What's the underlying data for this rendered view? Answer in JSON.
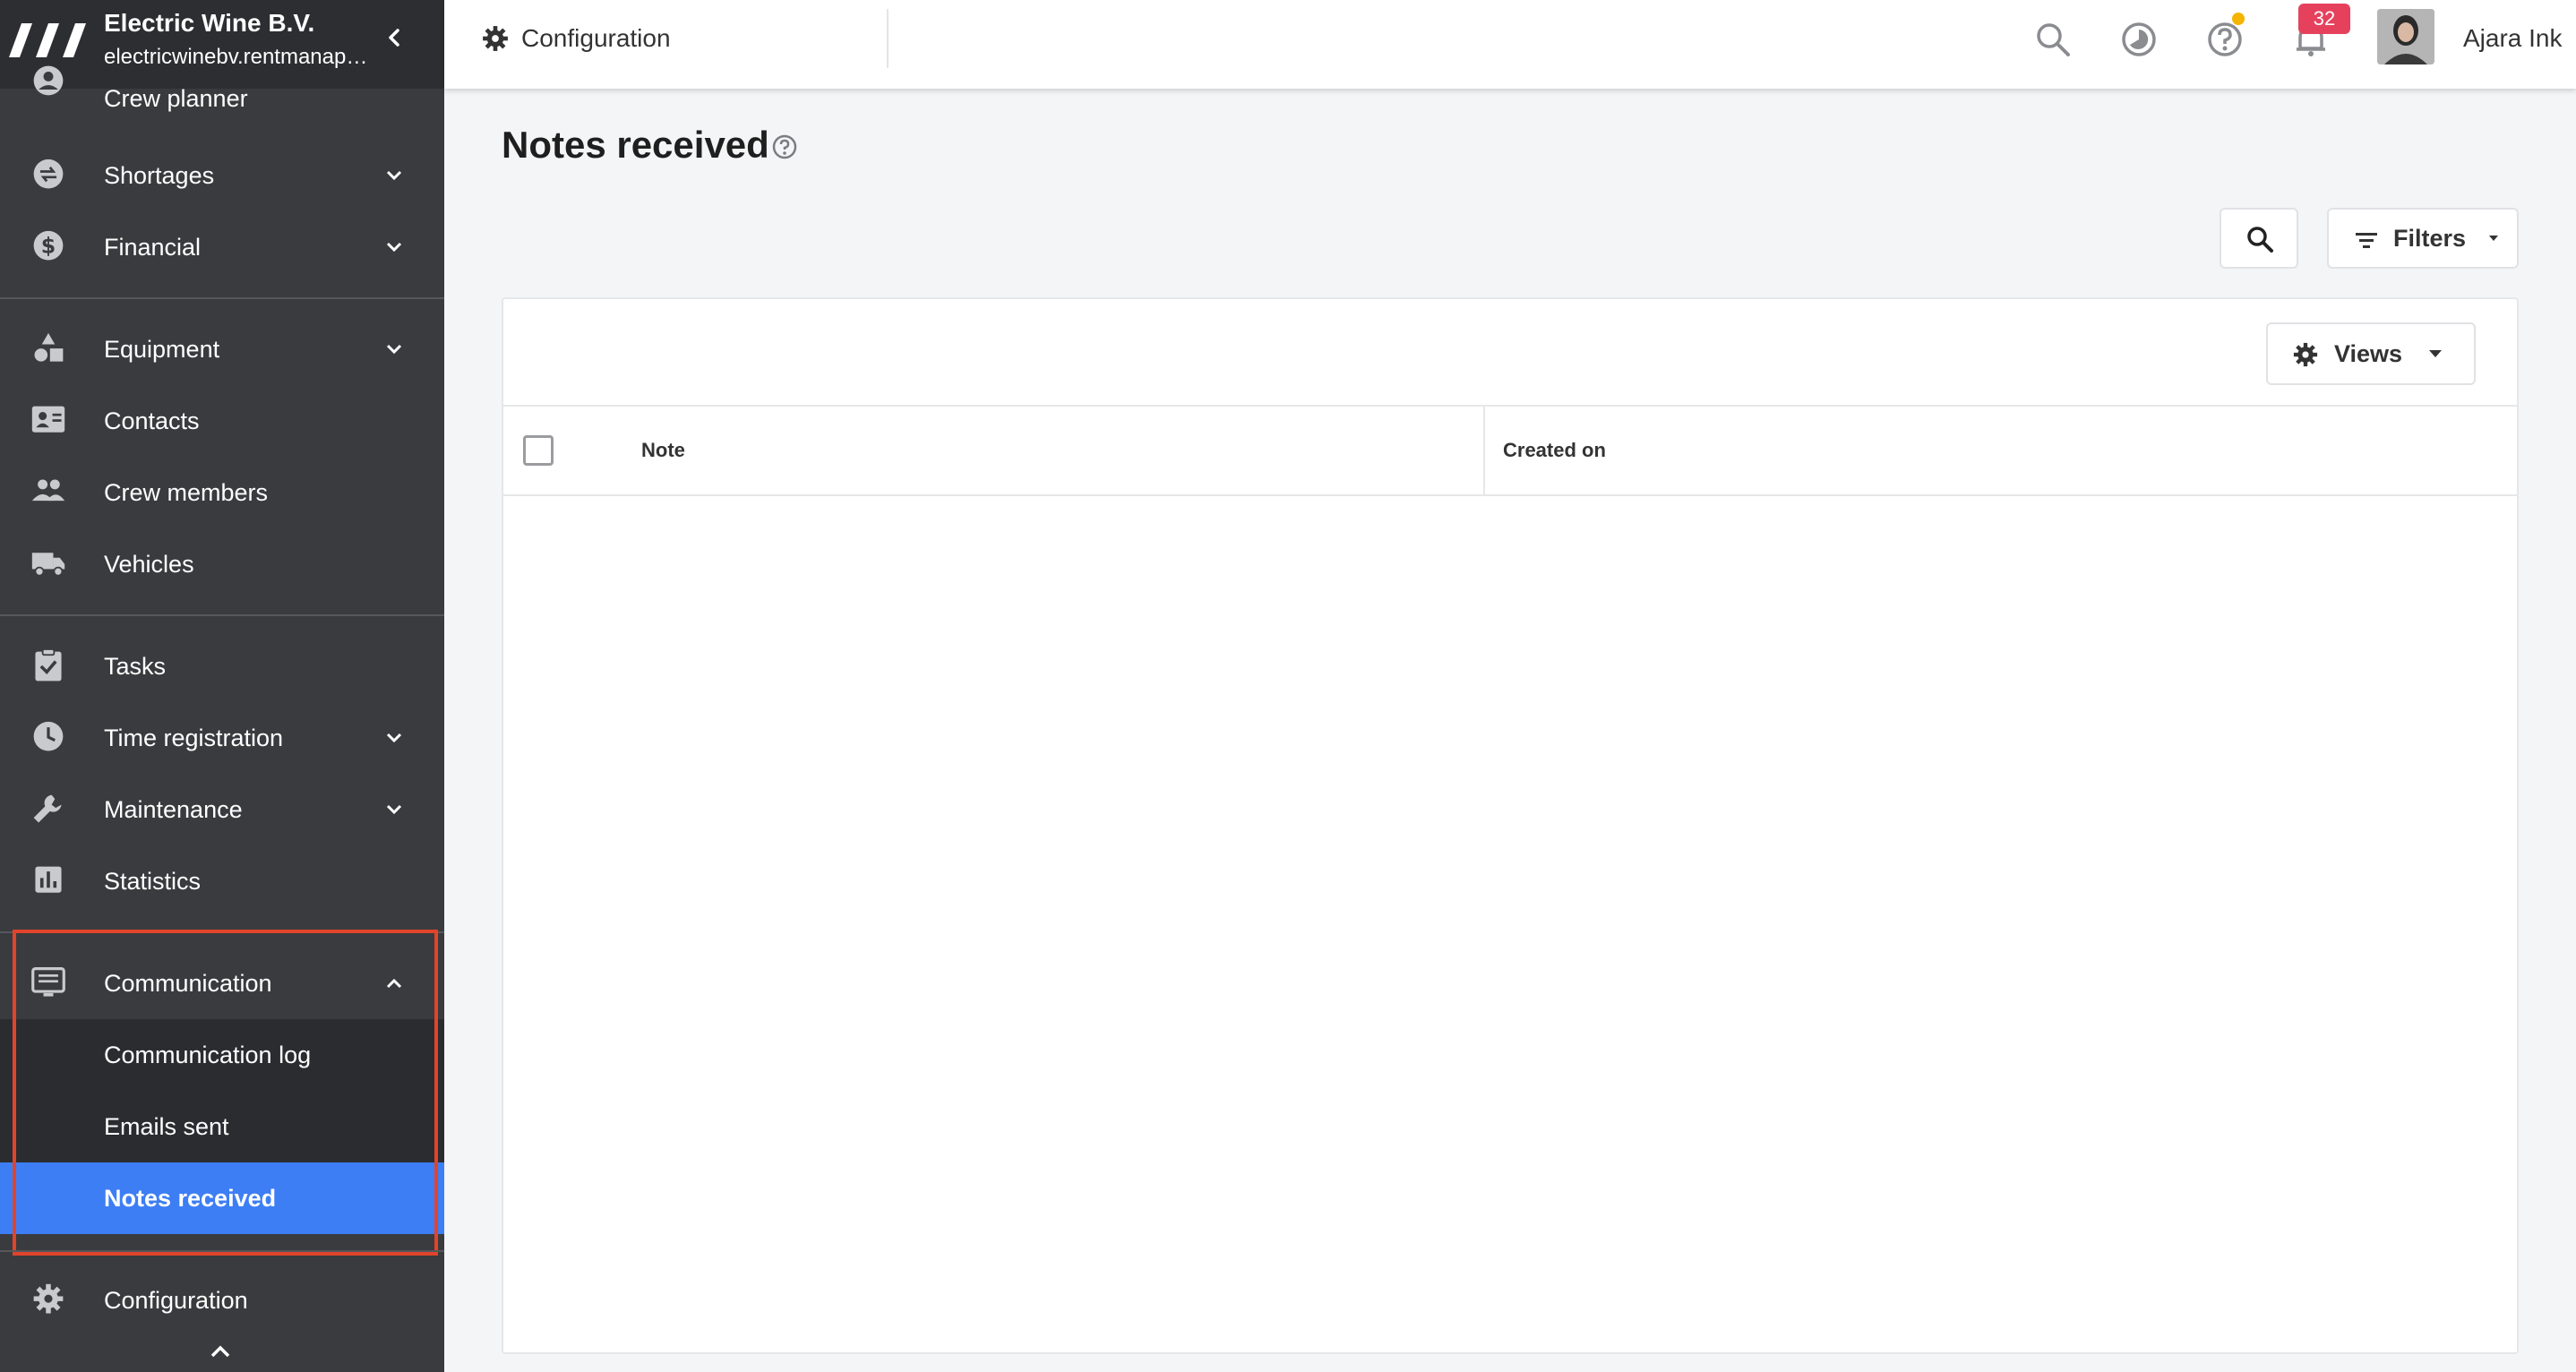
{
  "brand": {
    "name": "Electric Wine B.V.",
    "url": "electricwinebv.rentmanapp.com"
  },
  "sidebar": {
    "items": [
      {
        "label": "Crew planner",
        "icon": "person-circle-icon",
        "expandable": false
      },
      {
        "label": "Shortages",
        "icon": "swap-circle-icon",
        "expandable": true
      },
      {
        "label": "Financial",
        "icon": "dollar-circle-icon",
        "expandable": true
      },
      {
        "label": "Equipment",
        "icon": "shapes-icon",
        "expandable": true
      },
      {
        "label": "Contacts",
        "icon": "contact-card-icon",
        "expandable": false
      },
      {
        "label": "Crew members",
        "icon": "people-icon",
        "expandable": false
      },
      {
        "label": "Vehicles",
        "icon": "truck-icon",
        "expandable": false
      },
      {
        "label": "Tasks",
        "icon": "clipboard-check-icon",
        "expandable": false
      },
      {
        "label": "Time registration",
        "icon": "clock-icon",
        "expandable": true
      },
      {
        "label": "Maintenance",
        "icon": "wrench-icon",
        "expandable": true
      },
      {
        "label": "Statistics",
        "icon": "bar-chart-icon",
        "expandable": false
      },
      {
        "label": "Communication",
        "icon": "message-icon",
        "expandable": true,
        "expanded": true
      },
      {
        "label": "Configuration",
        "icon": "gear-icon",
        "expandable": false
      }
    ],
    "communication_sub": [
      {
        "label": "Communication log"
      },
      {
        "label": "Emails sent"
      },
      {
        "label": "Notes received",
        "active": true
      }
    ]
  },
  "topbar": {
    "section_label": "Configuration",
    "notifications_count": "32",
    "user_name": "Ajara Ink"
  },
  "main": {
    "page_title": "Notes received",
    "filters_label": "Filters",
    "views_label": "Views",
    "table": {
      "columns": [
        "Note",
        "Created on"
      ],
      "rows": []
    }
  },
  "colors": {
    "sidebar_bg": "#3a3b3e",
    "brand_bg": "#2d2e31",
    "active_item": "#3d7ef5",
    "highlight_box": "#e0442b",
    "badge": "#e5415d",
    "help_dot": "#f5b400"
  }
}
